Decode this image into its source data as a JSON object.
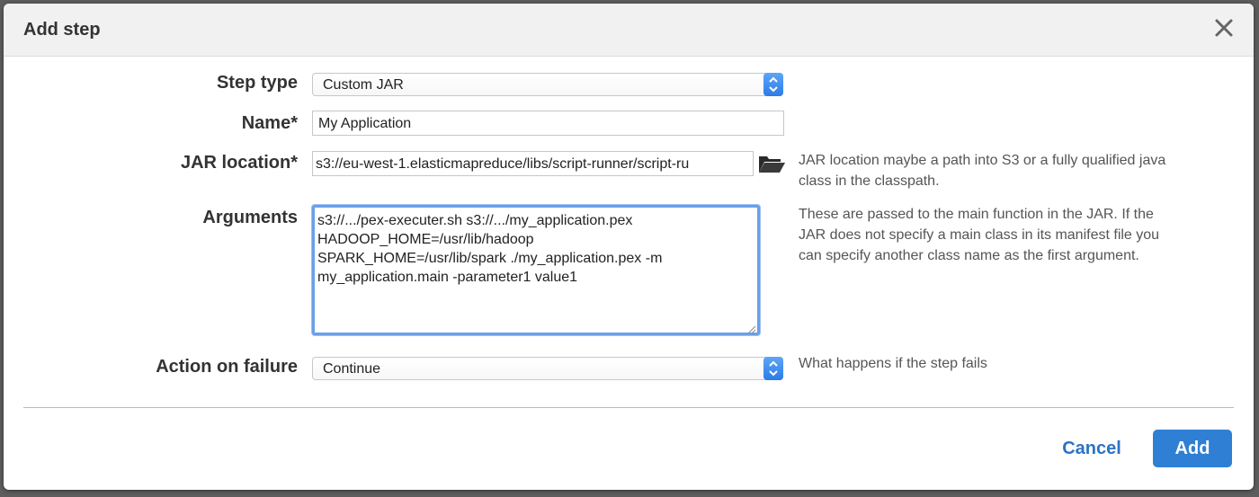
{
  "dialog": {
    "title": "Add step",
    "close_icon": "close-icon"
  },
  "form": {
    "step_type": {
      "label": "Step type",
      "value": "Custom JAR"
    },
    "name": {
      "label": "Name*",
      "value": "My Application"
    },
    "jar_location": {
      "label": "JAR location*",
      "value": "s3://eu-west-1.elasticmapreduce/libs/script-runner/script-ru",
      "help": [
        "JAR location maybe a path into S3 or a fully qualified java",
        "class in the classpath."
      ],
      "icon": "folder-icon"
    },
    "arguments": {
      "label": "Arguments",
      "lines": [
        "s3://.../pex-executer.sh s3://.../my_application.pex",
        "HADOOP_HOME=/usr/lib/hadoop",
        "SPARK_HOME=/usr/lib/spark ./my_application.pex -m",
        "my_application.main -parameter1 value1"
      ],
      "help": [
        "These are passed to the main function in the JAR. If the",
        "JAR does not specify a main class in its manifest file you",
        "can specify another class name as the first argument."
      ]
    },
    "action_on_failure": {
      "label": "Action on failure",
      "value": "Continue",
      "help": "What happens if the step fails"
    }
  },
  "footer": {
    "cancel_label": "Cancel",
    "add_label": "Add"
  },
  "colors": {
    "accent": "#2f7fd4",
    "link": "#2b73c4",
    "focus": "#6aa0e8"
  }
}
